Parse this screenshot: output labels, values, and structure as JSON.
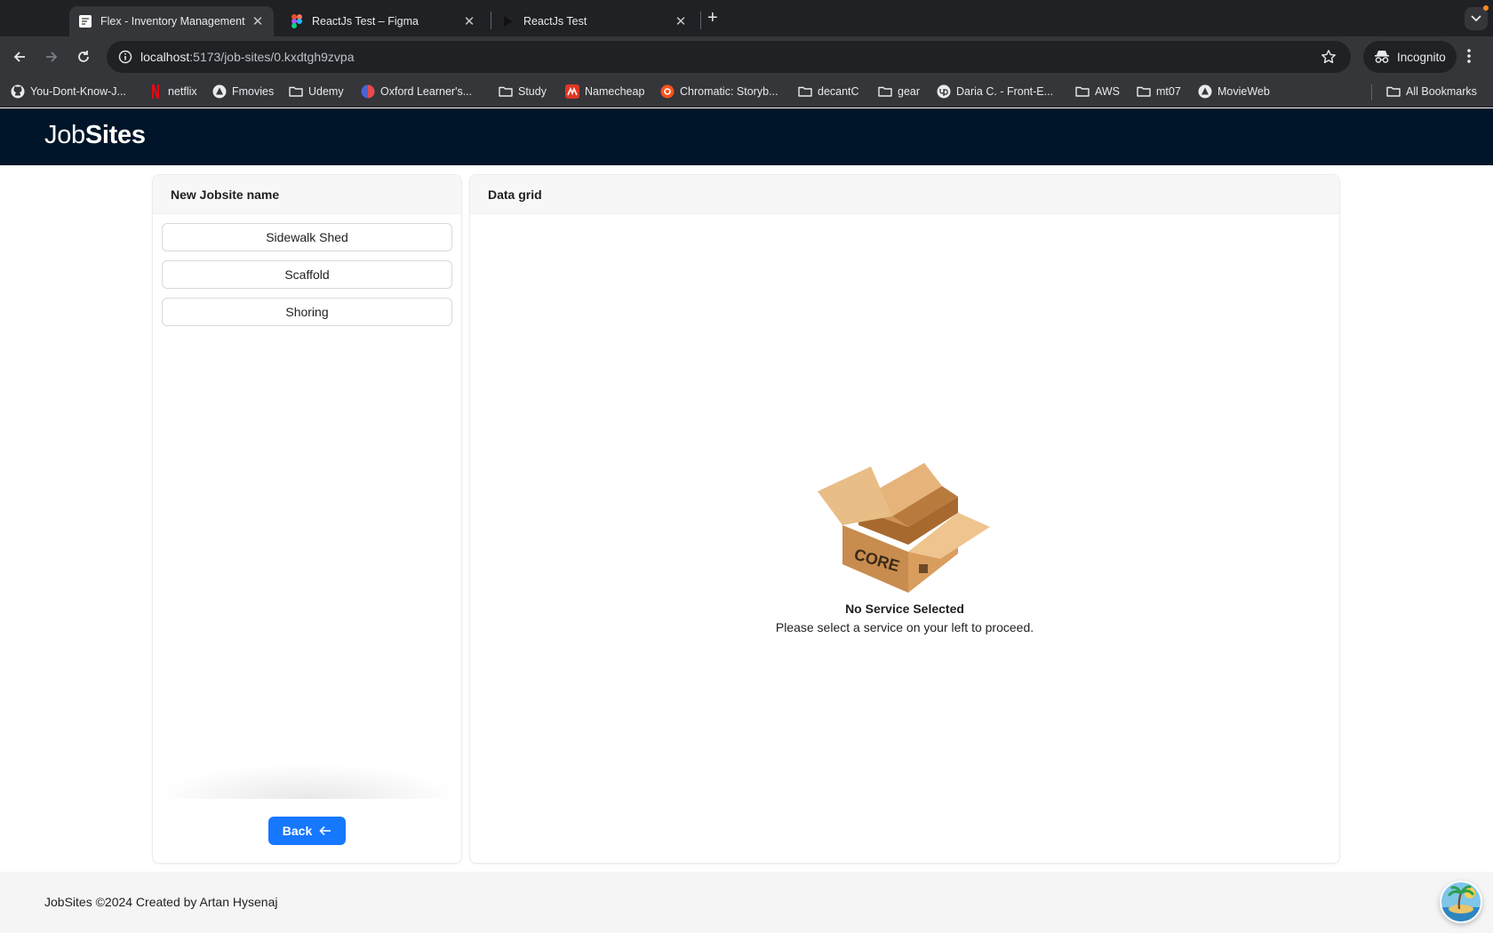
{
  "browser": {
    "tabs": [
      {
        "title": "Flex - Inventory Management",
        "icon": "flex-favicon",
        "active": true
      },
      {
        "title": "ReactJs Test – Figma",
        "icon": "figma-icon",
        "active": false
      },
      {
        "title": "ReactJs Test",
        "icon": "play-icon",
        "active": false
      }
    ],
    "close_glyph": "✕",
    "new_tab_glyph": "+",
    "url_host": "localhost",
    "url_path": ":5173/job-sites/0.kxdtgh9zvpa",
    "incognito_label": "Incognito",
    "bookmarks": [
      {
        "label": "You-Dont-Know-J...",
        "icon": "github-icon"
      },
      {
        "label": "netflix",
        "icon": "netflix-icon"
      },
      {
        "label": "Fmovies",
        "icon": "fmovies-icon"
      },
      {
        "label": "Udemy",
        "icon": "folder-icon"
      },
      {
        "label": "Oxford Learner's...",
        "icon": "oxford-icon"
      },
      {
        "label": "Study",
        "icon": "folder-icon"
      },
      {
        "label": "Namecheap",
        "icon": "namecheap-icon"
      },
      {
        "label": "Chromatic: Storyb...",
        "icon": "chromatic-icon"
      },
      {
        "label": "decantC",
        "icon": "folder-icon"
      },
      {
        "label": "gear",
        "icon": "folder-icon"
      },
      {
        "label": "Daria C. - Front-E...",
        "icon": "upwork-icon"
      },
      {
        "label": "AWS",
        "icon": "folder-icon"
      },
      {
        "label": "mt07",
        "icon": "folder-icon"
      },
      {
        "label": "MovieWeb",
        "icon": "movieweb-icon"
      }
    ],
    "all_bookmarks_label": "All Bookmarks"
  },
  "app": {
    "logo_light": "Job",
    "logo_bold": "Sites",
    "left_panel": {
      "title": "New Jobsite name",
      "services": [
        "Sidewalk Shed",
        "Scaffold",
        "Shoring"
      ],
      "back_label": "Back"
    },
    "right_panel": {
      "title": "Data grid",
      "empty_title": "No Service Selected",
      "empty_description": "Please select a service on your left to proceed.",
      "box_text": "CORE"
    },
    "footer_text": "JobSites ©2024 Created by Artan Hysenaj"
  },
  "colors": {
    "header_bg": "#001529",
    "primary": "#1677ff",
    "chrome_dark": "#202124",
    "chrome_mid": "#35363a"
  }
}
